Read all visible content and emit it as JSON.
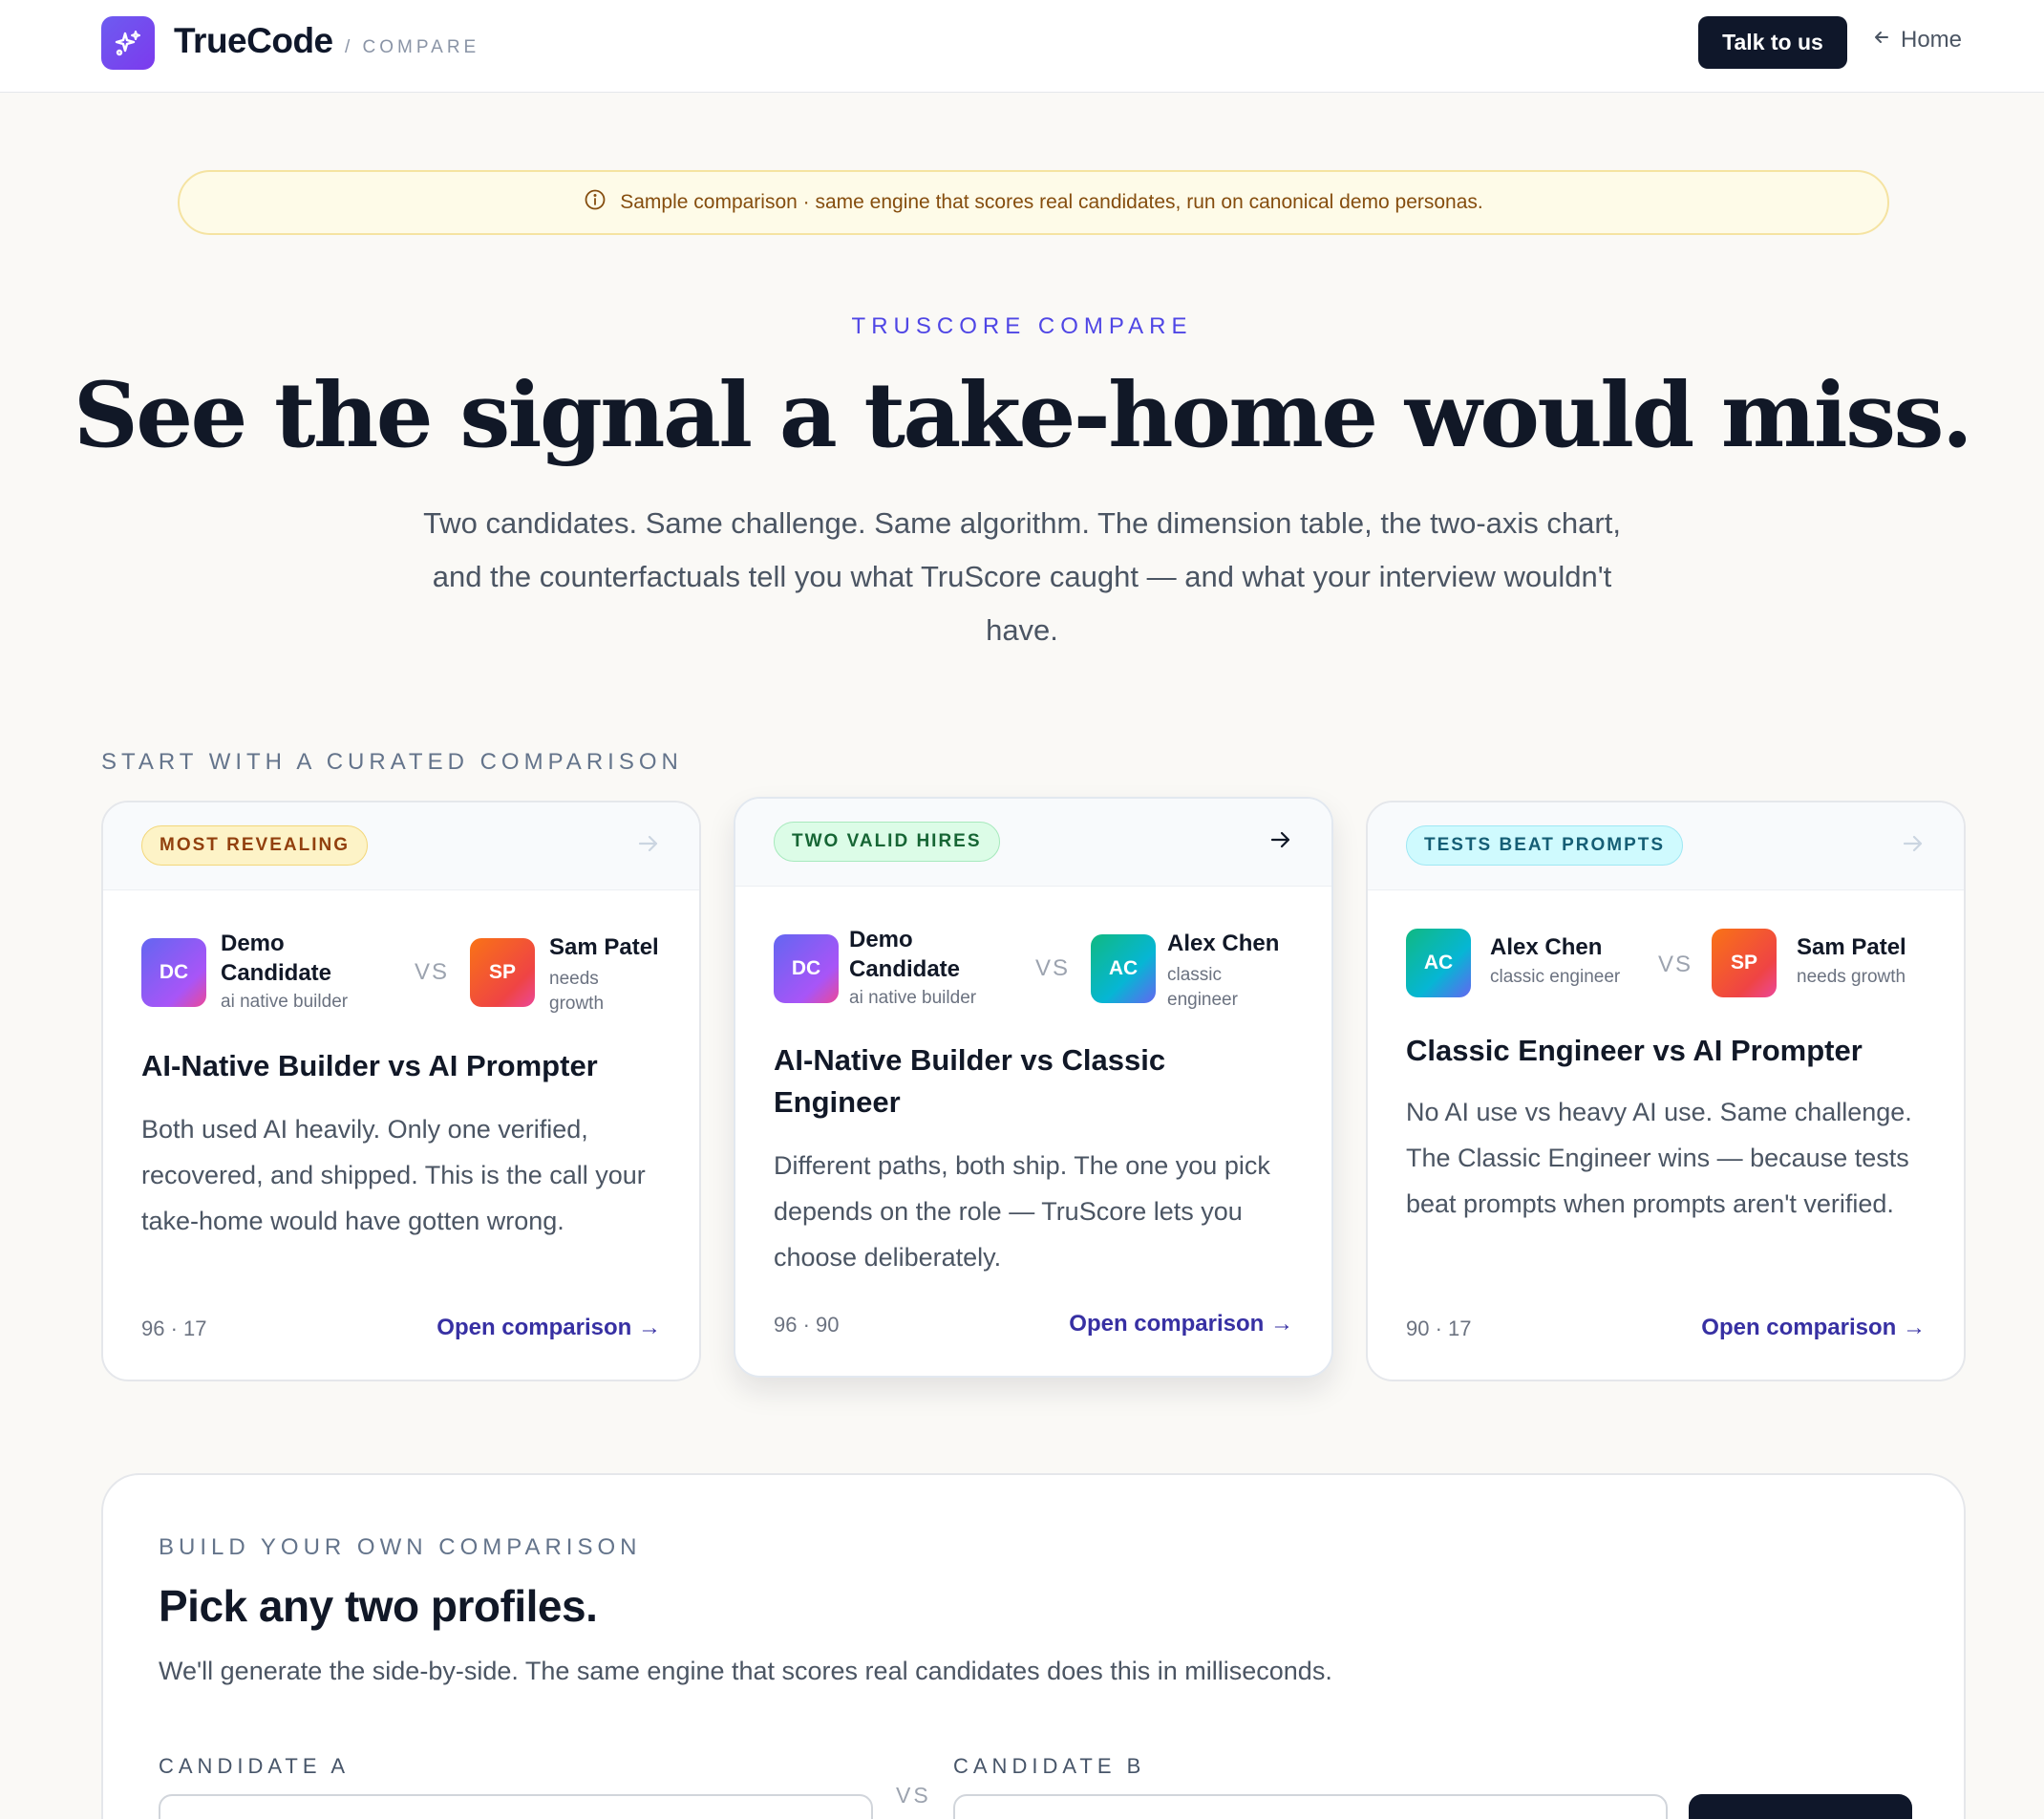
{
  "nav": {
    "brand": "TrueCode",
    "brand_sub": "/ COMPARE",
    "talk_button": "Talk to us",
    "home_link": "Home"
  },
  "banner": {
    "text": "Sample comparison · same engine that scores real candidates, run on canonical demo personas."
  },
  "hero": {
    "eyebrow": "TRUSCORE COMPARE",
    "title": "See the signal a take-home would miss.",
    "subtitle": "Two candidates. Same challenge. Same algorithm. The dimension table, the two-axis chart, and the counterfactuals tell you what TruScore caught — and what your interview wouldn't have."
  },
  "curated": {
    "label": "START WITH A CURATED COMPARISON",
    "vs": "VS",
    "cards": [
      {
        "badge": "MOST REVEALING",
        "a": {
          "initials": "DC",
          "name": "Demo Candidate",
          "role": "ai native builder"
        },
        "b": {
          "initials": "SP",
          "name": "Sam Patel",
          "role": "needs growth"
        },
        "title": "AI-Native Builder vs AI Prompter",
        "body": "Both used AI heavily. Only one verified, recovered, and shipped. This is the call your take-home would have gotten wrong.",
        "scores": "96 · 17",
        "link": "Open comparison →"
      },
      {
        "badge": "TWO VALID HIRES",
        "a": {
          "initials": "DC",
          "name": "Demo Candidate",
          "role": "ai native builder"
        },
        "b": {
          "initials": "AC",
          "name": "Alex Chen",
          "role": "classic engineer"
        },
        "title": "AI-Native Builder vs Classic Engineer",
        "body": "Different paths, both ship. The one you pick depends on the role — TruScore lets you choose deliberately.",
        "scores": "96 · 90",
        "link": "Open comparison →"
      },
      {
        "badge": "TESTS BEAT PROMPTS",
        "a": {
          "initials": "AC",
          "name": "Alex Chen",
          "role": "classic engineer"
        },
        "b": {
          "initials": "SP",
          "name": "Sam Patel",
          "role": "needs growth"
        },
        "title": "Classic Engineer vs AI Prompter",
        "body": "No AI use vs heavy AI use. Same challenge. The Classic Engineer wins — because tests beat prompts when prompts aren't verified.",
        "scores": "90 · 17",
        "link": "Open comparison →"
      }
    ]
  },
  "builder": {
    "label": "BUILD YOUR OWN COMPARISON",
    "title": "Pick any two profiles.",
    "subtitle": "We'll generate the side-by-side. The same engine that scores real candidates does this in milliseconds.",
    "candidate_a_label": "CANDIDATE A",
    "candidate_b_label": "CANDIDATE B",
    "vs": "VS"
  },
  "colors": {
    "accent": "#4f46e5",
    "dark": "#0f172a",
    "link": "#3730a3",
    "banner_bg": "#fefbe8"
  }
}
